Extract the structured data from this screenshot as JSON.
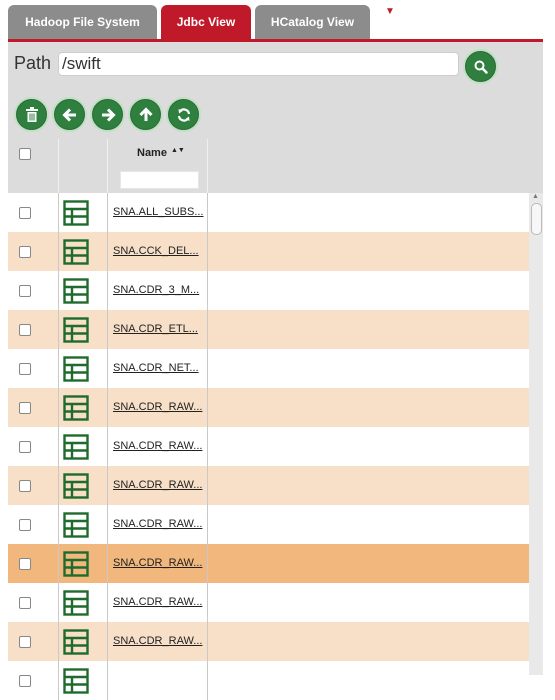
{
  "tabs": [
    {
      "label": "Hadoop File System",
      "active": false
    },
    {
      "label": "Jdbc View",
      "active": true
    },
    {
      "label": "HCatalog View",
      "active": false
    }
  ],
  "tab_menu_glyph": "▼",
  "path": {
    "label": "Path",
    "value": "/swift"
  },
  "toolbar": [
    "trash-icon",
    "arrow-left-icon",
    "arrow-right-icon",
    "arrow-up-icon",
    "refresh-icon"
  ],
  "table": {
    "header": {
      "name": "Name",
      "sort_glyph": "▲▼"
    },
    "rows": [
      {
        "name": "SNA.ALL_SUBS...",
        "style": "white"
      },
      {
        "name": "SNA.CCK_DEL...",
        "style": "peach"
      },
      {
        "name": "SNA.CDR_3_M...",
        "style": "white"
      },
      {
        "name": "SNA.CDR_ETL...",
        "style": "peach"
      },
      {
        "name": "SNA.CDR_NET...",
        "style": "white"
      },
      {
        "name": "SNA.CDR_RAW...",
        "style": "peach"
      },
      {
        "name": "SNA.CDR_RAW...",
        "style": "white"
      },
      {
        "name": "SNA.CDR_RAW...",
        "style": "peach"
      },
      {
        "name": "SNA.CDR_RAW...",
        "style": "white"
      },
      {
        "name": "SNA.CDR_RAW...",
        "style": "selected"
      },
      {
        "name": "SNA.CDR_RAW...",
        "style": "white"
      },
      {
        "name": "SNA.CDR_RAW...",
        "style": "peach"
      },
      {
        "name": "",
        "style": "white"
      }
    ]
  },
  "colors": {
    "accent": "#c0192a",
    "tab_inactive": "#8c8c8c",
    "button_green": "#2f7f3f",
    "row_peach": "#f8e0c8",
    "row_selected": "#f2b77c",
    "row_white": "#ffffff",
    "panel_grey": "#dcdcdc"
  }
}
